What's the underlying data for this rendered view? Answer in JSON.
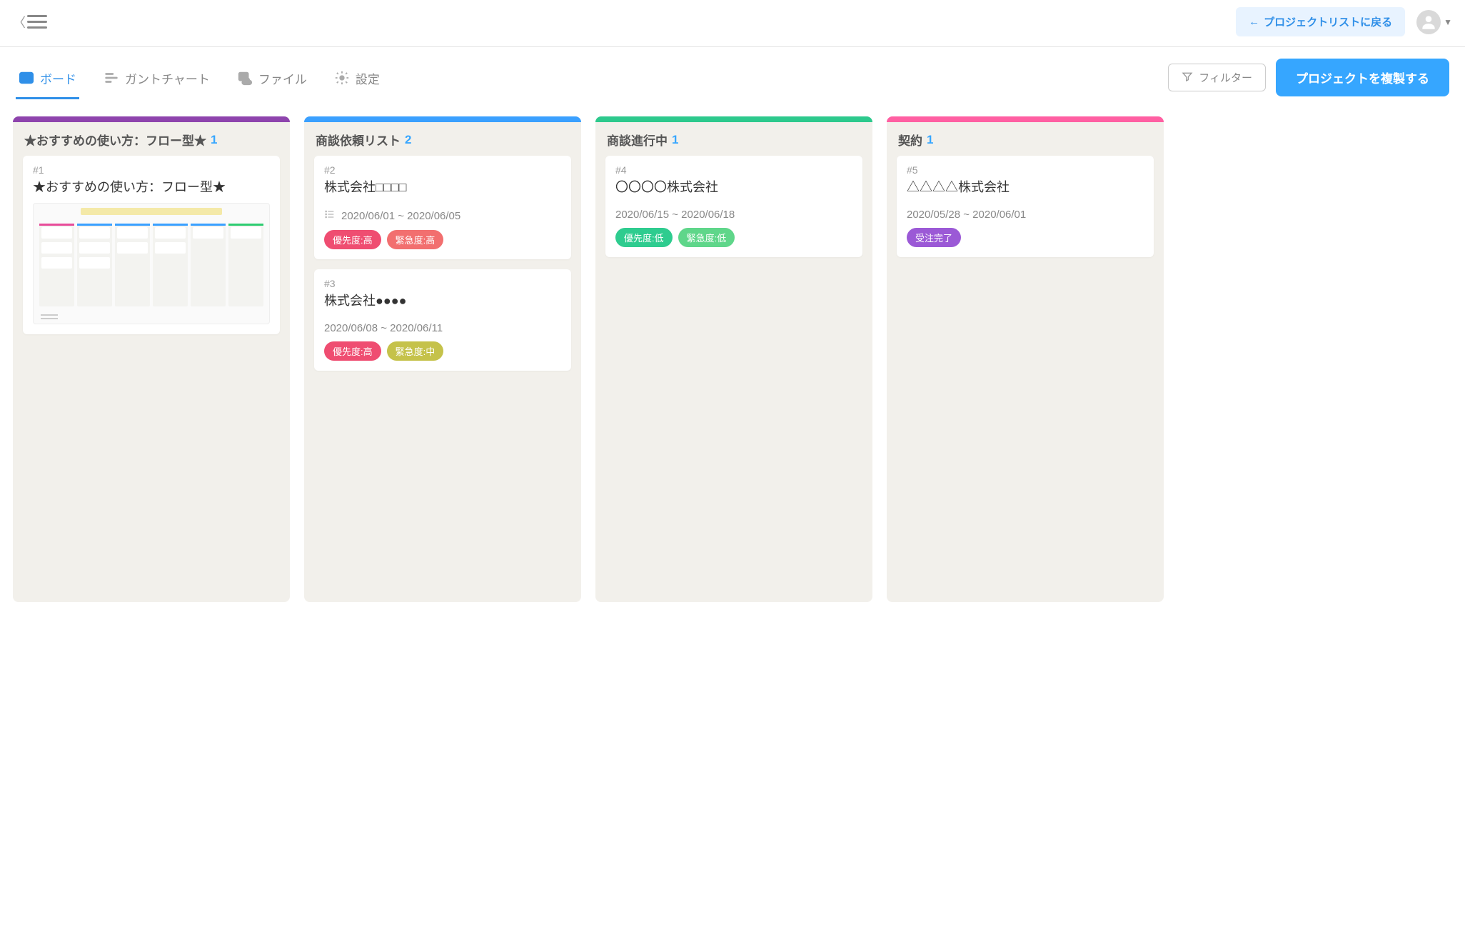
{
  "topbar": {
    "back_label": "プロジェクトリストに戻る"
  },
  "tabs": {
    "board": "ボード",
    "gantt": "ガントチャート",
    "file": "ファイル",
    "settings": "設定"
  },
  "toolbar": {
    "filter_label": "フィルター",
    "duplicate_label": "プロジェクトを複製する"
  },
  "columns": [
    {
      "title": "★おすすめの使い方：フロー型★",
      "count": "1",
      "stripe": "#8e44ad",
      "cards": [
        {
          "num": "#1",
          "title": "★おすすめの使い方：フロー型★",
          "has_thumb": true
        }
      ]
    },
    {
      "title": "商談依頼リスト",
      "count": "2",
      "stripe": "#3aa0ff",
      "cards": [
        {
          "num": "#2",
          "title": "株式会社□□□□",
          "dates": "2020/06/01 ~ 2020/06/05",
          "has_list_icon": true,
          "tags": [
            {
              "label": "優先度:高",
              "color": "#ef4d71"
            },
            {
              "label": "緊急度:高",
              "color": "#f26f6f"
            }
          ]
        },
        {
          "num": "#3",
          "title": "株式会社●●●●",
          "dates": "2020/06/08 ~ 2020/06/11",
          "tags": [
            {
              "label": "優先度:高",
              "color": "#ef4d71"
            },
            {
              "label": "緊急度:中",
              "color": "#c5c24a"
            }
          ]
        }
      ]
    },
    {
      "title": "商談進行中",
      "count": "1",
      "stripe": "#2dc98d",
      "cards": [
        {
          "num": "#4",
          "title": "〇〇〇〇株式会社",
          "dates": "2020/06/15 ~ 2020/06/18",
          "tags": [
            {
              "label": "優先度:低",
              "color": "#2ecc8f"
            },
            {
              "label": "緊急度:低",
              "color": "#5fd68a"
            }
          ]
        }
      ]
    },
    {
      "title": "契約",
      "count": "1",
      "stripe": "#ff5fa2",
      "cards": [
        {
          "num": "#5",
          "title": "△△△△株式会社",
          "dates": "2020/05/28 ~ 2020/06/01",
          "tags": [
            {
              "label": "受注完了",
              "color": "#9b59d6"
            }
          ]
        }
      ]
    }
  ]
}
